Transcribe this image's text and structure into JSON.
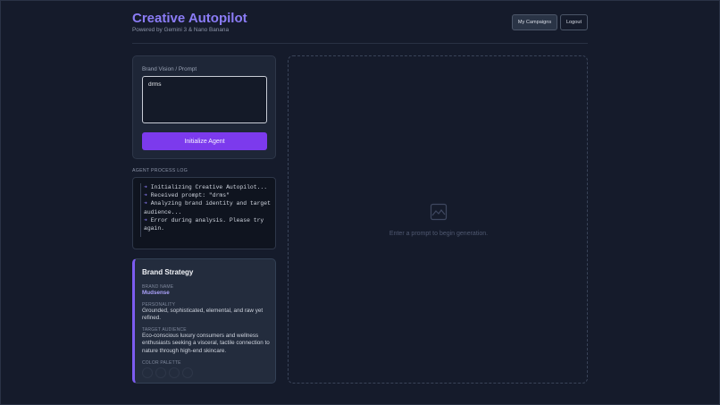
{
  "header": {
    "title": "Creative Autopilot",
    "subtitle": "Powered by Gemini 3 & Nano Banana",
    "my_campaigns_label": "My Campaigns",
    "logout_label": "Logout"
  },
  "prompt_panel": {
    "label": "Brand Vision / Prompt",
    "value": "drms",
    "button_label": "Initialize Agent"
  },
  "log": {
    "title": "AGENT PROCESS LOG",
    "arrow": "➔",
    "lines": [
      "Initializing Creative Autopilot...",
      "Received prompt: \"drms\"",
      "Analyzing brand identity and target audience...",
      "Error during analysis. Please try again."
    ]
  },
  "strategy": {
    "title": "Brand Strategy",
    "brand_name_label": "BRAND NAME",
    "brand_name": "Mudsense",
    "personality_label": "PERSONALITY",
    "personality": "Grounded, sophisticated, elemental, and raw yet refined.",
    "audience_label": "TARGET AUDIENCE",
    "audience": "Eco-conscious luxury consumers and wellness enthusiasts seeking a visceral, tactile connection to nature through high-end skincare.",
    "palette_label": "COLOR PALETTE",
    "palette": [
      "#232c3d",
      "#232c3d",
      "#232c3d",
      "#232c3d"
    ]
  },
  "preview": {
    "icon": "image-icon",
    "placeholder": "Enter a prompt to begin generation."
  },
  "colors": {
    "accent": "#7c3aed",
    "title": "#8b7cf6",
    "background": "#151b2b"
  }
}
